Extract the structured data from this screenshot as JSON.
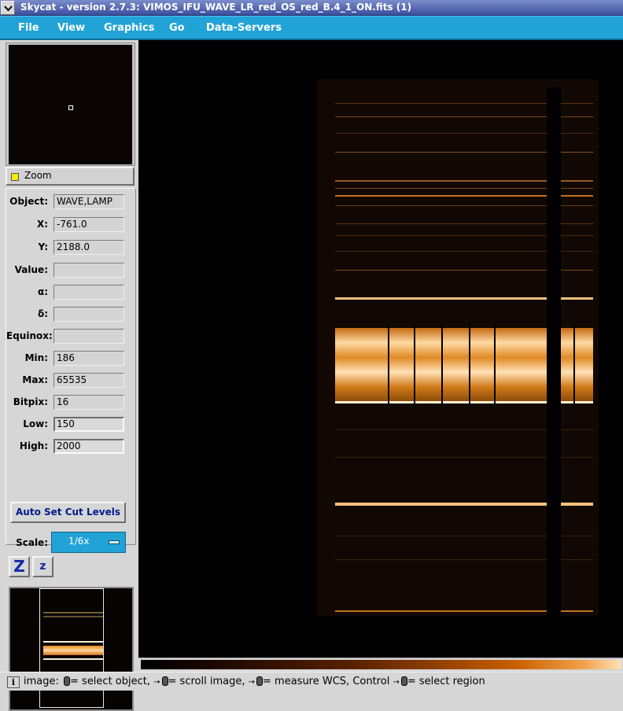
{
  "window": {
    "title": "Skycat - version 2.7.3: VIMOS_IFU_WAVE_LR_red_OS_red_B.4_1_ON.fits (1)"
  },
  "menu": {
    "file": "File",
    "view": "View",
    "graphics": "Graphics",
    "go": "Go",
    "data_servers": "Data-Servers"
  },
  "zoom": {
    "label": "Zoom"
  },
  "info": {
    "object_label": "Object:",
    "object_value": "WAVE,LAMP",
    "x_label": "X:",
    "x_value": "-761.0",
    "y_label": "Y:",
    "y_value": "2188.0",
    "value_label": "Value:",
    "value_value": "",
    "alpha_label": "α:",
    "alpha_value": "",
    "delta_label": "δ:",
    "delta_value": "",
    "equinox_label": "Equinox:",
    "equinox_value": "",
    "min_label": "Min:",
    "min_value": "186",
    "max_label": "Max:",
    "max_value": "65535",
    "bitpix_label": "Bitpix:",
    "bitpix_value": "16",
    "low_label": "Low:",
    "low_value": "150",
    "high_label": "High:",
    "high_value": "2000"
  },
  "controls": {
    "autoset_label": "Auto Set Cut Levels",
    "scale_label": "Scale:",
    "scale_value": "1/6x",
    "zoom_in_label": "Z",
    "zoom_out_label": "z"
  },
  "status": {
    "icon_label": "i",
    "prefix": "image:",
    "select_object": "= select object,",
    "scroll_image": "= scroll image,",
    "measure_wcs": "= measure WCS, Control",
    "select_region": "= select region"
  },
  "colors": {
    "menubar": "#21a3d7",
    "titlebar": "#3b4f9e",
    "emission_line": "#f6c27a",
    "colormap_high": "#ffe2b8"
  }
}
